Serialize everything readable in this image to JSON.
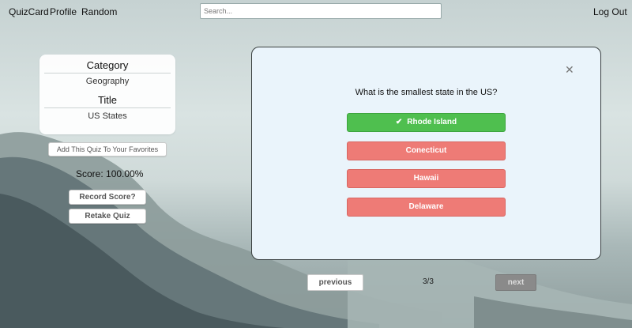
{
  "nav": {
    "brand": "QuizCard",
    "profile": "Profile",
    "random": "Random",
    "logout": "Log Out",
    "search_placeholder": "Search..."
  },
  "quiz_info": {
    "category_label": "Category",
    "category_value": "Geography",
    "title_label": "Title",
    "title_value": "US States",
    "favorite_button": "Add This Quiz To Your Favorites",
    "score_text": "Score: 100.00%",
    "record_button": "Record Score?",
    "retake_button": "Retake Quiz"
  },
  "question_card": {
    "close_icon": "close-icon",
    "question": "What is the smallest state in the US?",
    "answers": [
      {
        "label": "Rhode Island",
        "state": "correct",
        "icon": "check-icon"
      },
      {
        "label": "Conecticut",
        "state": "wrong"
      },
      {
        "label": "Hawaii",
        "state": "wrong"
      },
      {
        "label": "Delaware",
        "state": "wrong"
      }
    ]
  },
  "pager": {
    "previous": "previous",
    "counter": "3/3",
    "next": "next"
  },
  "colors": {
    "correct": "#4fbf4f",
    "wrong": "#ee7b76",
    "card_bg": "#eaf4fb"
  }
}
